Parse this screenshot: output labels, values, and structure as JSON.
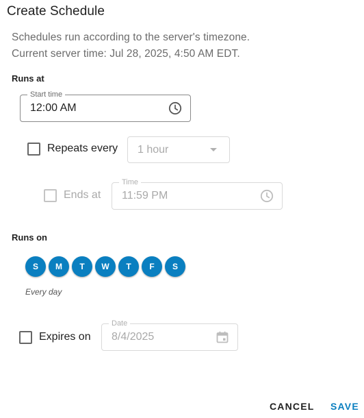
{
  "dialog": {
    "title": "Create Schedule",
    "description_line1": "Schedules run according to the server's timezone.",
    "description_line2": "Current server time: Jul 28, 2025, 4:50 AM EDT."
  },
  "runs_at": {
    "section_label": "Runs at",
    "start_time": {
      "legend": "Start time",
      "value": "12:00 AM",
      "icon": "clock-icon"
    },
    "repeats": {
      "label": "Repeats every",
      "checked": false,
      "interval_value": "1 hour",
      "icon": "chevron-down-icon"
    },
    "ends_at": {
      "label": "Ends at",
      "checked": false,
      "legend": "Time",
      "value": "11:59 PM",
      "icon": "clock-icon"
    }
  },
  "runs_on": {
    "section_label": "Runs on",
    "days": [
      {
        "letter": "S",
        "selected": true
      },
      {
        "letter": "M",
        "selected": true
      },
      {
        "letter": "T",
        "selected": true
      },
      {
        "letter": "W",
        "selected": true
      },
      {
        "letter": "T",
        "selected": true
      },
      {
        "letter": "F",
        "selected": true
      },
      {
        "letter": "S",
        "selected": true
      }
    ],
    "summary": "Every day"
  },
  "expires": {
    "label": "Expires on",
    "checked": false,
    "legend": "Date",
    "value": "8/4/2025",
    "icon": "calendar-icon"
  },
  "actions": {
    "cancel_label": "CANCEL",
    "save_label": "SAVE"
  },
  "colors": {
    "accent": "#0a7fc0",
    "text": "#212121",
    "muted": "#6b6b6b",
    "disabled": "#a9a9a9"
  }
}
